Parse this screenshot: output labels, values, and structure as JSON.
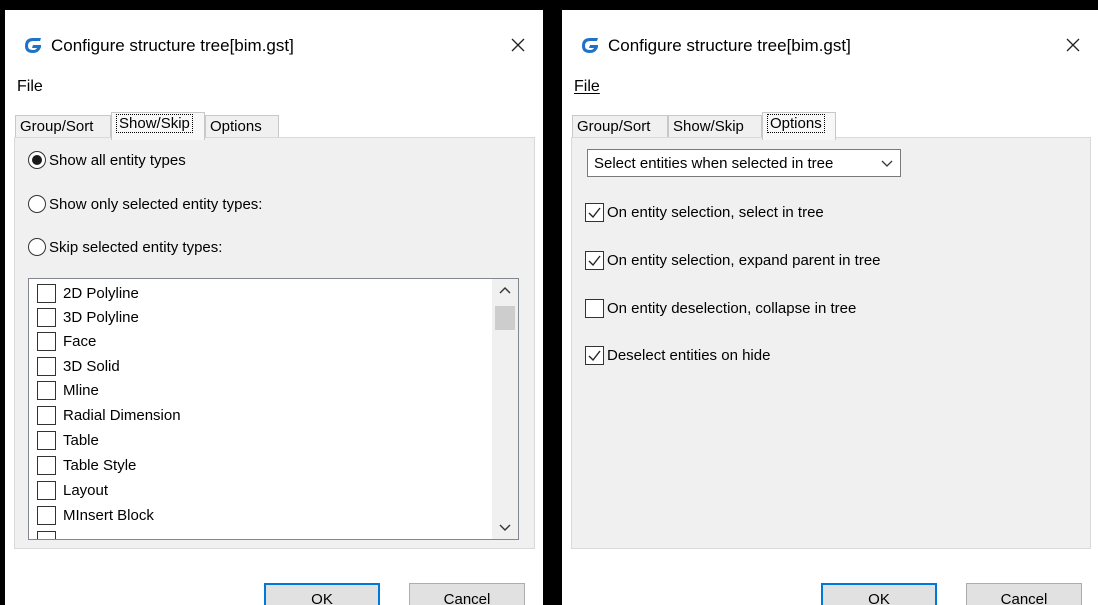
{
  "app": {
    "icon": "gstarcad-g-icon",
    "accent": "#1e73c8"
  },
  "dialogs": [
    {
      "title": "Configure structure tree[bim.gst]",
      "menu": {
        "file_label": "File"
      },
      "tabs": [
        {
          "label": "Group/Sort",
          "active": false
        },
        {
          "label": "Show/Skip",
          "active": true
        },
        {
          "label": "Options",
          "active": false
        }
      ],
      "show_skip": {
        "radios": [
          {
            "label": "Show all entity types",
            "selected": true
          },
          {
            "label": "Show only selected entity types:",
            "selected": false
          },
          {
            "label": "Skip selected entity types:",
            "selected": false
          }
        ],
        "entity_types": [
          {
            "label": "2D Polyline",
            "checked": false
          },
          {
            "label": "3D Polyline",
            "checked": false
          },
          {
            "label": "Face",
            "checked": false
          },
          {
            "label": "3D Solid",
            "checked": false
          },
          {
            "label": "Mline",
            "checked": false
          },
          {
            "label": "Radial Dimension",
            "checked": false
          },
          {
            "label": "Table",
            "checked": false
          },
          {
            "label": "Table Style",
            "checked": false
          },
          {
            "label": "Layout",
            "checked": false
          },
          {
            "label": "MInsert Block",
            "checked": false
          }
        ]
      },
      "buttons": {
        "ok_label": "OK",
        "cancel_label": "Cancel"
      }
    },
    {
      "title": "Configure structure tree[bim.gst]",
      "menu": {
        "file_label": "File"
      },
      "tabs": [
        {
          "label": "Group/Sort",
          "active": false
        },
        {
          "label": "Show/Skip",
          "active": false
        },
        {
          "label": "Options",
          "active": true
        }
      ],
      "options": {
        "selection_mode": "Select entities when selected in tree",
        "checkboxes": [
          {
            "label": "On entity selection, select in tree",
            "checked": true
          },
          {
            "label": "On entity selection, expand parent in tree",
            "checked": true
          },
          {
            "label": "On entity deselection, collapse in tree",
            "checked": false
          },
          {
            "label": "Deselect entities on hide",
            "checked": true
          }
        ]
      },
      "buttons": {
        "ok_label": "OK",
        "cancel_label": "Cancel"
      }
    }
  ]
}
